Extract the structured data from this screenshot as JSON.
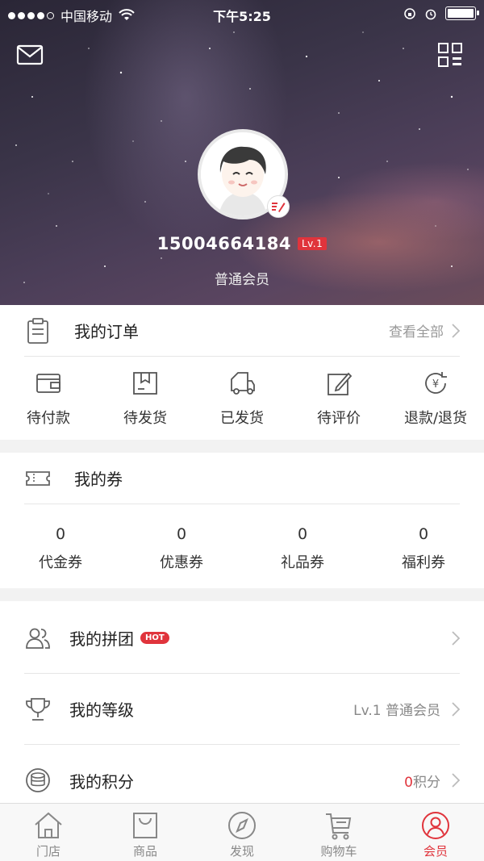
{
  "status_bar": {
    "carrier": "中国移动",
    "time": "下午5:25"
  },
  "profile": {
    "phone": "15004664184",
    "level_badge": "Lv.1",
    "member_type": "普通会员"
  },
  "orders": {
    "title": "我的订单",
    "view_all": "查看全部",
    "items": [
      {
        "label": "待付款",
        "icon": "wallet-icon"
      },
      {
        "label": "待发货",
        "icon": "package-icon"
      },
      {
        "label": "已发货",
        "icon": "truck-icon"
      },
      {
        "label": "待评价",
        "icon": "edit-review-icon"
      },
      {
        "label": "退款/退货",
        "icon": "refund-icon"
      }
    ]
  },
  "coupons": {
    "title": "我的券",
    "items": [
      {
        "count": "0",
        "label": "代金券"
      },
      {
        "count": "0",
        "label": "优惠券"
      },
      {
        "count": "0",
        "label": "礼品券"
      },
      {
        "count": "0",
        "label": "福利券"
      }
    ]
  },
  "menu": {
    "group_buy": {
      "title": "我的拼团",
      "badge": "HOT"
    },
    "level": {
      "title": "我的等级",
      "value": "Lv.1 普通会员"
    },
    "points": {
      "title": "我的积分",
      "value_number": "0",
      "value_unit": "积分"
    }
  },
  "tabbar": {
    "items": [
      {
        "label": "门店",
        "icon": "store-icon"
      },
      {
        "label": "商品",
        "icon": "shopping-bag-icon"
      },
      {
        "label": "发现",
        "icon": "compass-icon"
      },
      {
        "label": "购物车",
        "icon": "cart-icon"
      },
      {
        "label": "会员",
        "icon": "member-icon"
      }
    ],
    "active_index": 4
  },
  "colors": {
    "accent": "#e0343c"
  }
}
